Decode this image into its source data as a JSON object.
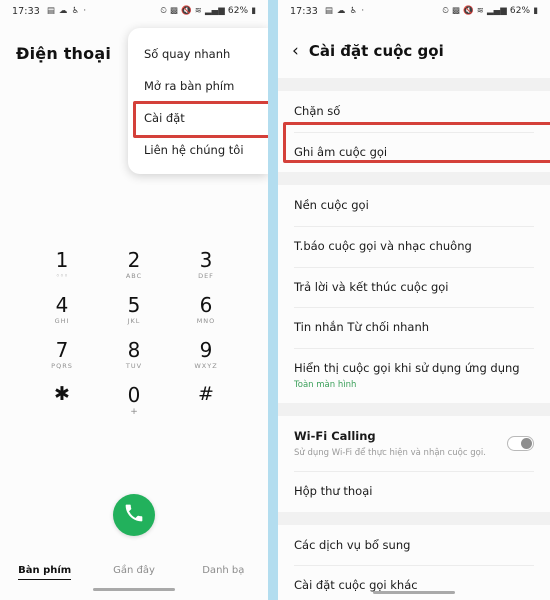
{
  "status_bar": {
    "time": "17:33",
    "left_icons": [
      "gallery-icon",
      "cloud-icon",
      "accessibility-icon",
      "dot-icon"
    ],
    "right_icons": [
      "alarm-icon",
      "vibrate-icon",
      "mute-icon",
      "wifi-icon",
      "signal-icon"
    ],
    "battery": "62%"
  },
  "colors": {
    "accent_green": "#22b15c",
    "highlight_red": "#d4403a",
    "divider_blue": "#b3ddef",
    "subtitle_green": "#3ba05a"
  },
  "left_panel": {
    "title": "Điện thoại",
    "menu": {
      "items": [
        {
          "label": "Số quay nhanh",
          "highlighted": false
        },
        {
          "label": "Mở ra bàn phím",
          "highlighted": false
        },
        {
          "label": "Cài đặt",
          "highlighted": true
        },
        {
          "label": "Liên hệ chúng tôi",
          "highlighted": false
        }
      ]
    },
    "dialpad": [
      {
        "num": "1",
        "sub": "◦◦◦",
        "sub_kind": "vm"
      },
      {
        "num": "2",
        "sub": "ABC",
        "sub_kind": "letters"
      },
      {
        "num": "3",
        "sub": "DEF",
        "sub_kind": "letters"
      },
      {
        "num": "4",
        "sub": "GHI",
        "sub_kind": "letters"
      },
      {
        "num": "5",
        "sub": "JKL",
        "sub_kind": "letters"
      },
      {
        "num": "6",
        "sub": "MNO",
        "sub_kind": "letters"
      },
      {
        "num": "7",
        "sub": "PQRS",
        "sub_kind": "letters"
      },
      {
        "num": "8",
        "sub": "TUV",
        "sub_kind": "letters"
      },
      {
        "num": "9",
        "sub": "WXYZ",
        "sub_kind": "letters"
      },
      {
        "num": "✱",
        "sub": "",
        "sub_kind": "none"
      },
      {
        "num": "0",
        "sub": "+",
        "sub_kind": "plus"
      },
      {
        "num": "#",
        "sub": "",
        "sub_kind": "none"
      }
    ],
    "call_button": "call-icon",
    "tabs": [
      {
        "label": "Bàn phím",
        "active": true
      },
      {
        "label": "Gần đây",
        "active": false
      },
      {
        "label": "Danh bạ",
        "active": false
      }
    ]
  },
  "right_panel": {
    "header": {
      "back": "chevron-left-icon",
      "title": "Cài đặt cuộc gọi"
    },
    "sections": [
      {
        "rows": [
          {
            "title": "Chặn số",
            "sub": "",
            "sub_green": false,
            "toggle": null,
            "highlighted": false
          },
          {
            "title": "Ghi âm cuộc gọi",
            "sub": "",
            "sub_green": false,
            "toggle": null,
            "highlighted": true
          }
        ]
      },
      {
        "rows": [
          {
            "title": "Nền cuộc gọi",
            "sub": "",
            "sub_green": false,
            "toggle": null,
            "highlighted": false
          },
          {
            "title": "T.báo cuộc gọi và nhạc chuông",
            "sub": "",
            "sub_green": false,
            "toggle": null,
            "highlighted": false
          },
          {
            "title": "Trả lời và kết thúc cuộc gọi",
            "sub": "",
            "sub_green": false,
            "toggle": null,
            "highlighted": false
          },
          {
            "title": "Tin nhắn Từ chối nhanh",
            "sub": "",
            "sub_green": false,
            "toggle": null,
            "highlighted": false
          },
          {
            "title": "Hiển thị cuộc gọi khi sử dụng ứng dụng",
            "sub": "Toàn màn hình",
            "sub_green": true,
            "toggle": null,
            "highlighted": false
          }
        ]
      },
      {
        "rows": [
          {
            "title": "Wi-Fi Calling",
            "sub": "Sử dụng Wi-Fi để thực hiện và nhận cuộc gọi.",
            "sub_green": false,
            "toggle": "off",
            "highlighted": false
          },
          {
            "title": "Hộp thư thoại",
            "sub": "",
            "sub_green": false,
            "toggle": null,
            "highlighted": false
          }
        ]
      },
      {
        "rows": [
          {
            "title": "Các dịch vụ bổ sung",
            "sub": "",
            "sub_green": false,
            "toggle": null,
            "highlighted": false
          },
          {
            "title": "Cài đặt cuộc gọi khác",
            "sub": "",
            "sub_green": false,
            "toggle": null,
            "highlighted": false
          }
        ]
      }
    ]
  }
}
